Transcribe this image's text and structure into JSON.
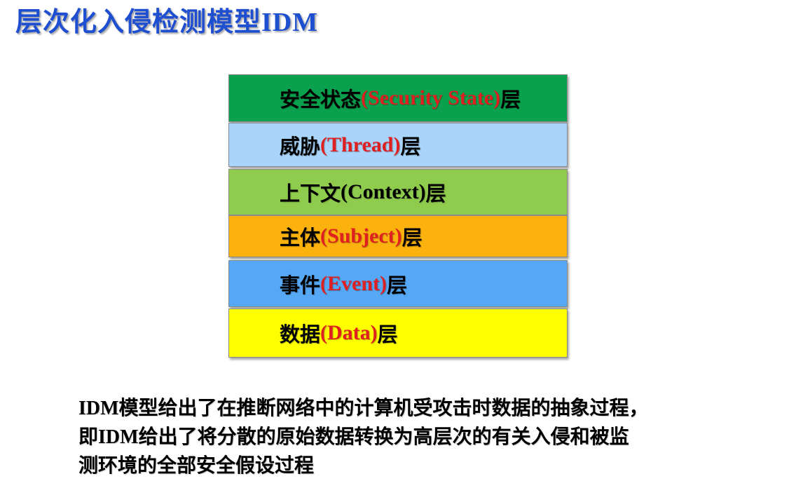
{
  "slide": {
    "title_cn": "层次化入侵检测模型",
    "title_en": "IDM",
    "layers": [
      {
        "prefix": "安全状态",
        "en": "(Security State)",
        "suffix": "层",
        "color": "#0aa14e",
        "en_color": "#e02020"
      },
      {
        "prefix": "威胁",
        "en": "(Thread)",
        "suffix": "层",
        "color": "#a9d4fb",
        "en_color": "#e02020"
      },
      {
        "prefix": "上下文",
        "en": "(Context)",
        "suffix": "层",
        "color": "#8fcc4d",
        "en_color": "#000000"
      },
      {
        "prefix": "主体",
        "en": "(Subject)",
        "suffix": "层",
        "color": "#fbb20f",
        "en_color": "#e02020"
      },
      {
        "prefix": "事件",
        "en": "(Event)",
        "suffix": "层",
        "color": "#56a8f5",
        "en_color": "#e02020"
      },
      {
        "prefix": "数据",
        "en": "(Data)",
        "suffix": "层",
        "color": "#ffff00",
        "en_color": "#e02020"
      }
    ],
    "description": {
      "line1_en": "IDM",
      "line1_cn": "模型给出了在推断网络中的计算机受攻击时数据的抽象过程，",
      "line2_cn_a": "即",
      "line2_en": "IDM",
      "line2_cn_b": "给出了将分散的原始数据转换为高层次的有关入侵和被监",
      "line3_cn": "测环境的全部安全假设过程"
    }
  }
}
